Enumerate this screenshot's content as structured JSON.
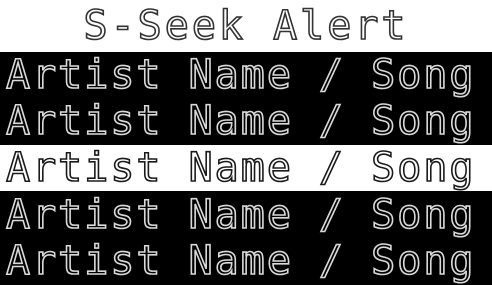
{
  "header": {
    "title": "S-Seek Alert"
  },
  "list": {
    "items": [
      {
        "label": "Artist Name / Song",
        "selected": false
      },
      {
        "label": "Artist Name / Song",
        "selected": false
      },
      {
        "label": "Artist Name / Song",
        "selected": true
      },
      {
        "label": "Artist Name / Song",
        "selected": false
      },
      {
        "label": "Artist Name / Song",
        "selected": false
      }
    ]
  },
  "colors": {
    "background": "#000000",
    "text": "#d9d9d9",
    "highlight": "#ffffff"
  }
}
